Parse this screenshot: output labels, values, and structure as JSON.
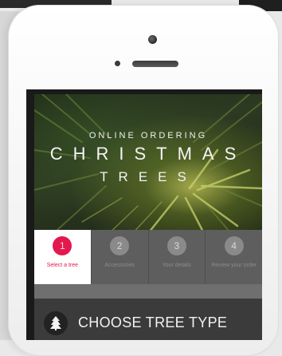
{
  "hero": {
    "subtitle": "ONLINE ORDERING",
    "title_line1": "CHRISTMAS",
    "title_line2": "TREES"
  },
  "steps": [
    {
      "number": "1",
      "label": "Select a tree",
      "active": true
    },
    {
      "number": "2",
      "label": "Accessories",
      "active": false
    },
    {
      "number": "3",
      "label": "Your details",
      "active": false
    },
    {
      "number": "4",
      "label": "Review your order",
      "active": false
    }
  ],
  "section": {
    "title": "CHOOSE TREE TYPE",
    "icon": "tree-icon"
  },
  "colors": {
    "accent": "#e2194f",
    "step_bg": "#5e5e5e",
    "bar_bg": "#3b3b3b"
  }
}
